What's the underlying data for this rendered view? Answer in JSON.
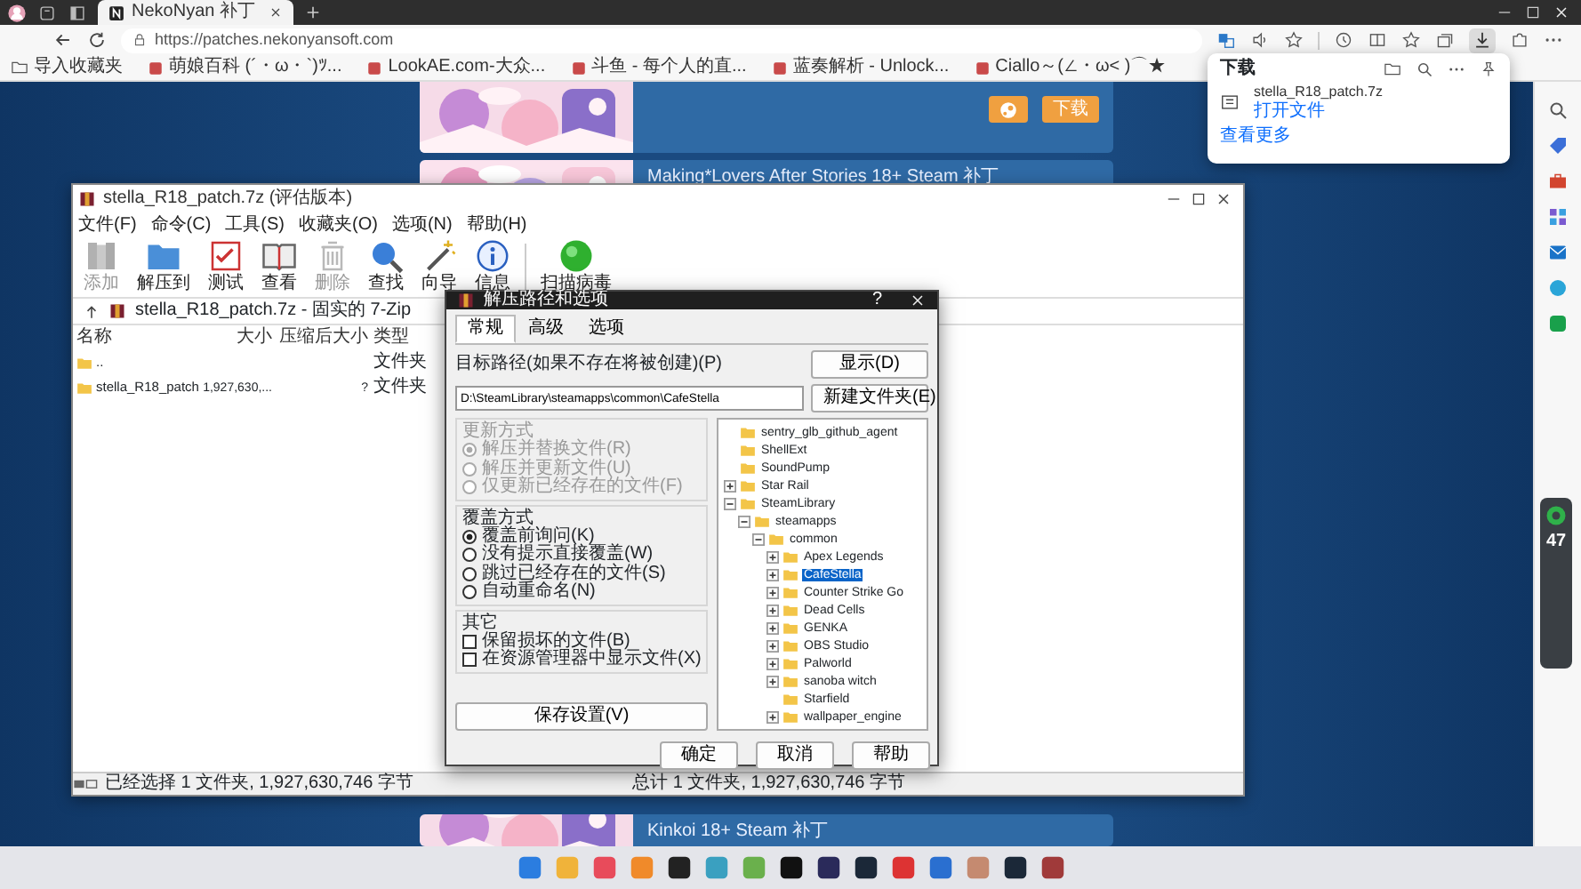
{
  "browser": {
    "tabs": [
      {
        "label": "NekoNyan 补丁",
        "selected": true
      }
    ],
    "address": "https://patches.nekonyansoft.com",
    "bookmarks": [
      {
        "label": "导入收藏夹",
        "kind": "folder"
      },
      {
        "label": "萌娘百科 (´・ω・`)ﾂ...",
        "kind": "site"
      },
      {
        "label": "LookAE.com-大众...",
        "kind": "site"
      },
      {
        "label": "斗鱼 - 每个人的直...",
        "kind": "site"
      },
      {
        "label": "蓝奏解析 - Unlock...",
        "kind": "site"
      },
      {
        "label": "Ciallo～(∠・ω< )⌒★",
        "kind": "site"
      }
    ],
    "download_button": {
      "selected": true
    }
  },
  "downloads": {
    "title": "下载",
    "items": [
      {
        "file": "stella_R18_patch.7z",
        "action": "打开文件"
      }
    ],
    "more": "查看更多"
  },
  "page": {
    "cards": [
      {
        "kind": "buttons",
        "button": "下载"
      },
      {
        "kind": "title",
        "title": "Making*Lovers After Stories 18+ Steam 补丁"
      },
      {
        "kind": "title",
        "title": "Kinkoi 18+ Steam 补丁"
      }
    ]
  },
  "winrar": {
    "title": "stella_R18_patch.7z (评估版本)",
    "menu": [
      "文件(F)",
      "命令(C)",
      "工具(S)",
      "收藏夹(O)",
      "选项(N)",
      "帮助(H)"
    ],
    "tools": [
      {
        "label": "添加",
        "kind": "add",
        "disabled": true
      },
      {
        "label": "解压到",
        "kind": "extract",
        "disabled": false
      },
      {
        "label": "测试",
        "kind": "test",
        "disabled": false
      },
      {
        "label": "查看",
        "kind": "view",
        "disabled": false
      },
      {
        "label": "删除",
        "kind": "delete",
        "disabled": true
      },
      {
        "label": "查找",
        "kind": "find",
        "disabled": false
      },
      {
        "label": "向导",
        "kind": "wizard",
        "disabled": false
      },
      {
        "label": "信息",
        "kind": "info",
        "disabled": false
      },
      {
        "label": "扫描病毒",
        "kind": "scan",
        "disabled": false
      }
    ],
    "path": "stella_R18_patch.7z - 固实的 7-Zip",
    "columns": [
      "名称",
      "大小",
      "压缩后大小",
      "类型"
    ],
    "rows": [
      {
        "name": "..",
        "type": "文件夹"
      },
      {
        "name": "stella_R18_patch",
        "size": "1,927,630,...",
        "packed": "?",
        "type": "文件夹"
      }
    ],
    "status": [
      "已经选择 1 文件夹, 1,927,630,746 字节",
      "总计 1 文件夹, 1,927,630,746 字节"
    ]
  },
  "dialog": {
    "title": "解压路径和选项",
    "help": "?",
    "tabs": [
      {
        "label": "常规",
        "selected": true
      },
      {
        "label": "高级",
        "selected": false
      },
      {
        "label": "选项",
        "selected": false
      }
    ],
    "target_label": "目标路径(如果不存在将被创建)(P)",
    "target": "D:\\SteamLibrary\\steamapps\\common\\CafeStella",
    "side_buttons": [
      "显示(D)",
      "新建文件夹(E)"
    ],
    "groups": [
      {
        "title": "更新方式",
        "kind": "radio",
        "disabled": true,
        "options": [
          {
            "label": "解压并替换文件(R)",
            "selected": true
          },
          {
            "label": "解压并更新文件(U)",
            "selected": false
          },
          {
            "label": "仅更新已经存在的文件(F)",
            "selected": false
          }
        ]
      },
      {
        "title": "覆盖方式",
        "kind": "radio",
        "disabled": false,
        "options": [
          {
            "label": "覆盖前询问(K)",
            "selected": true
          },
          {
            "label": "没有提示直接覆盖(W)",
            "selected": false
          },
          {
            "label": "跳过已经存在的文件(S)",
            "selected": false
          },
          {
            "label": "自动重命名(N)",
            "selected": false
          }
        ]
      },
      {
        "title": "其它",
        "kind": "check",
        "disabled": false,
        "options": [
          {
            "label": "保留损坏的文件(B)",
            "checked": false
          },
          {
            "label": "在资源管理器中显示文件(X)",
            "checked": false
          }
        ]
      }
    ],
    "save": "保存设置(V)",
    "tree": [
      {
        "label": "sentry_glb_github_agent",
        "selected": false
      },
      {
        "label": "ShellExt",
        "selected": false
      },
      {
        "label": "SoundPump",
        "selected": false
      },
      {
        "label": "Star Rail",
        "selected": false,
        "expanded": false
      },
      {
        "label": "SteamLibrary",
        "selected": false,
        "expanded": true,
        "children": [
          {
            "label": "steamapps",
            "selected": false,
            "expanded": true,
            "children": [
              {
                "label": "common",
                "selected": false,
                "expanded": true,
                "children": [
                  {
                    "label": "Apex Legends",
                    "selected": false,
                    "expanded": false
                  },
                  {
                    "label": "CafeStella",
                    "selected": true,
                    "expanded": false
                  },
                  {
                    "label": "Counter Strike Go",
                    "selected": false,
                    "expanded": false
                  },
                  {
                    "label": "Dead Cells",
                    "selected": false,
                    "expanded": false
                  },
                  {
                    "label": "GENKA",
                    "selected": false,
                    "expanded": false
                  },
                  {
                    "label": "OBS Studio",
                    "selected": false,
                    "expanded": false
                  },
                  {
                    "label": "Palworld",
                    "selected": false,
                    "expanded": false
                  },
                  {
                    "label": "sanoba witch",
                    "selected": false,
                    "expanded": false
                  },
                  {
                    "label": "Starfield",
                    "selected": false
                  },
                  {
                    "label": "wallpaper_engine",
                    "selected": false,
                    "expanded": false
                  }
                ]
              }
            ]
          }
        ]
      }
    ],
    "buttons": [
      "确定",
      "取消",
      "帮助"
    ]
  },
  "widget": {
    "reading": "47"
  }
}
